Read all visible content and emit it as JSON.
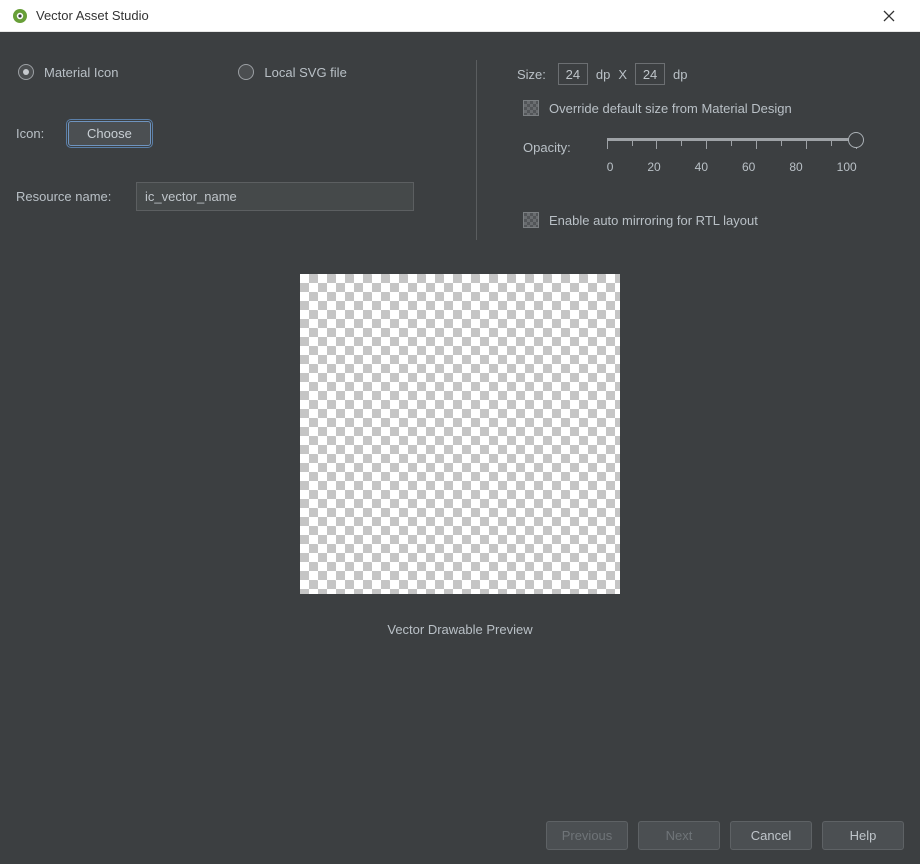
{
  "window": {
    "title": "Vector Asset Studio"
  },
  "left": {
    "radio_material": "Material Icon",
    "radio_svg": "Local SVG file",
    "icon_label": "Icon:",
    "choose_label": "Choose",
    "resource_name_label": "Resource name:",
    "resource_name_value": "ic_vector_name"
  },
  "right": {
    "size_label": "Size:",
    "size_w": "24",
    "size_dp1": "dp",
    "size_x": "X",
    "size_h": "24",
    "size_dp2": "dp",
    "override_label": "Override default size from Material Design",
    "opacity_label": "Opacity:",
    "opacity_ticks": {
      "t0": "0",
      "t20": "20",
      "t40": "40",
      "t60": "60",
      "t80": "80",
      "t100": "100"
    },
    "rtl_label": "Enable auto mirroring for RTL layout"
  },
  "preview": {
    "caption": "Vector Drawable Preview"
  },
  "footer": {
    "previous": "Previous",
    "next": "Next",
    "cancel": "Cancel",
    "help": "Help"
  }
}
